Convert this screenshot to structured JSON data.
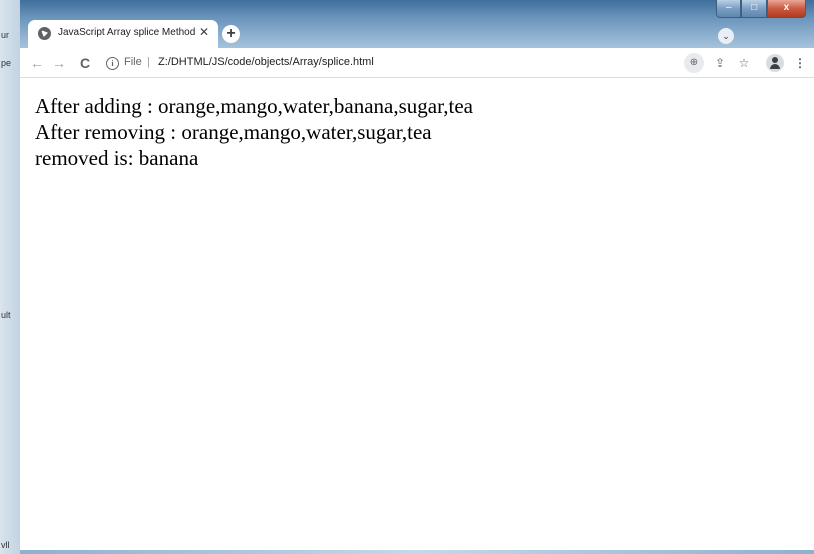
{
  "desktop": {
    "left_labels": [
      "ur",
      "pe",
      "ult",
      "vll"
    ]
  },
  "browser": {
    "tab": {
      "title": "JavaScript Array splice Method",
      "close_glyph": "✕"
    },
    "new_tab_glyph": "+",
    "tab_search_glyph": "⌄",
    "window_controls": {
      "minimize_glyph": "–",
      "maximize_glyph": "□",
      "close_glyph": "x"
    },
    "toolbar": {
      "back_glyph": "←",
      "forward_glyph": "→",
      "reload_glyph": "C",
      "info_glyph": "i",
      "scheme_label": "File",
      "separator": "|",
      "url": "Z:/DHTML/JS/code/objects/Array/splice.html",
      "zoom_glyph": "⊕",
      "share_glyph": "⇪",
      "star_glyph": "☆",
      "menu_glyph": "⋮"
    }
  },
  "page": {
    "lines": [
      "After adding : orange,mango,water,banana,sugar,tea",
      "After removing : orange,mango,water,sugar,tea",
      "removed is: banana"
    ]
  }
}
